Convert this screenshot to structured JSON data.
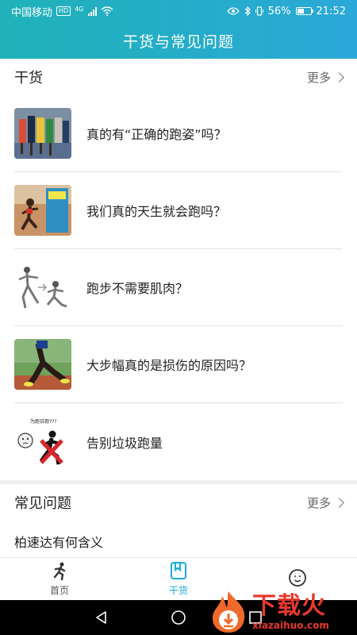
{
  "status_bar": {
    "carrier": "中国移动",
    "hd": "HD",
    "network": "4G",
    "battery": "56%",
    "time": "21:52"
  },
  "header": {
    "title": "干货与常见问题"
  },
  "articles_section": {
    "title": "干货",
    "more": "更多",
    "items": [
      {
        "title": "真的有“正确的跑姿”吗？",
        "icon": "photo-runners-race"
      },
      {
        "title": "我们真的天生就会跑吗？",
        "icon": "photo-barefoot-runner-book"
      },
      {
        "title": "跑步不需要肌肉？",
        "icon": "drawing-running-poses"
      },
      {
        "title": "大步幅真的是损伤的原因吗？",
        "icon": "photo-runner-stride"
      },
      {
        "title": "告别垃圾跑量",
        "icon": "cartoon-no-running"
      }
    ]
  },
  "faq_section": {
    "title": "常见问题",
    "more": "更多",
    "items": [
      {
        "title": "柏速达有何含义"
      }
    ]
  },
  "tabbar": {
    "tabs": [
      {
        "label": "首页",
        "icon": "runner-icon",
        "active": false
      },
      {
        "label": "干货",
        "icon": "bookmark-icon",
        "active": true
      },
      {
        "label": "",
        "icon": "user-icon",
        "active": false
      }
    ]
  },
  "watermark": {
    "title": "下载火",
    "url": "xiazaihuo.com"
  },
  "colors": {
    "header_start": "#20b2b8",
    "header_end": "#2aa8d8",
    "accent": "#19a9d6",
    "watermark": "#e8392b"
  }
}
